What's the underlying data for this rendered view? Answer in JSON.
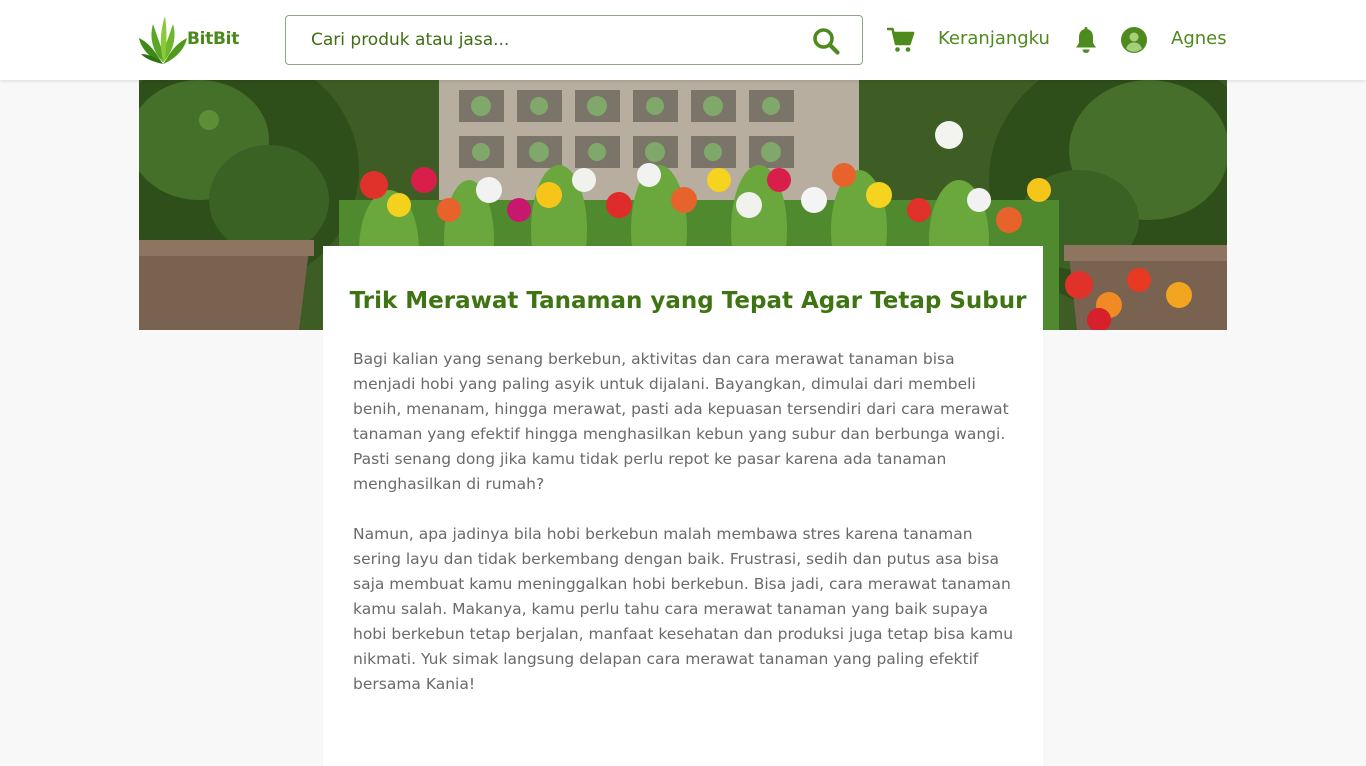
{
  "brand": {
    "name": "BitBit",
    "primary_color": "#4e8a1e",
    "logo_icon": "leaf-logo-icon"
  },
  "header": {
    "search": {
      "placeholder": "Cari produk atau jasa...",
      "value": "",
      "icon": "search-icon"
    },
    "cart": {
      "icon": "cart-icon",
      "label": "Keranjangku"
    },
    "notifications": {
      "icon": "bell-icon"
    },
    "user": {
      "icon": "user-avatar-icon",
      "name": "Agnes"
    }
  },
  "hero": {
    "image": "garden-flowers-banner"
  },
  "article": {
    "title": "Trik Merawat Tanaman yang Tepat Agar Tetap Subur",
    "paragraphs": [
      "Bagi kalian yang senang berkebun, aktivitas dan cara merawat tanaman bisa menjadi hobi yang paling asyik untuk dijalani. Bayangkan, dimulai dari membeli benih, menanam, hingga merawat, pasti ada kepuasan tersendiri dari cara merawat tanaman yang efektif hingga menghasilkan kebun yang subur dan berbunga wangi. Pasti senang dong jika kamu tidak perlu repot ke pasar karena ada tanaman menghasilkan di rumah?",
      "Namun, apa jadinya bila hobi berkebun malah membawa stres karena tanaman sering layu dan tidak berkembang dengan baik. Frustrasi, sedih dan putus asa bisa saja membuat kamu meninggalkan hobi berkebun. Bisa jadi, cara merawat tanaman kamu salah. Makanya, kamu perlu tahu cara merawat tanaman yang baik supaya hobi berkebun tetap berjalan, manfaat kesehatan dan produksi juga tetap bisa kamu nikmati. Yuk simak langsung delapan cara merawat tanaman yang paling efektif bersama Kania!"
    ]
  }
}
